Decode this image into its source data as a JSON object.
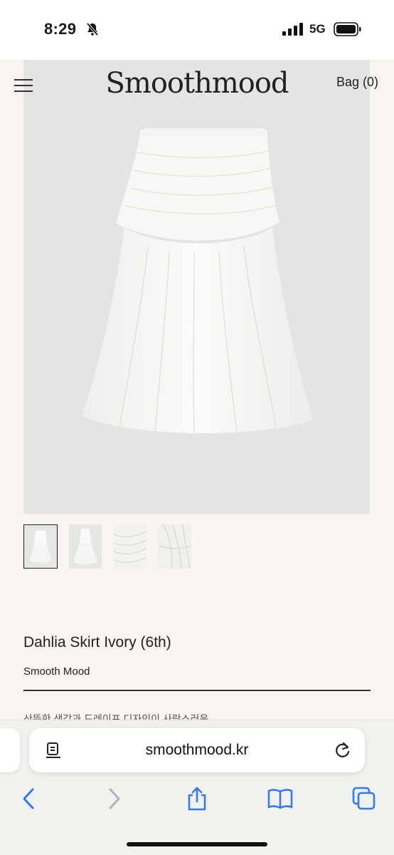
{
  "status": {
    "time": "8:29",
    "network": "5G"
  },
  "header": {
    "logo": "Smoothmood",
    "bag_label": "Bag (0)"
  },
  "product": {
    "title": "Dahlia Skirt Ivory (6th)",
    "brand": "Smooth Mood",
    "description_partial": "산뜻한 색감과 드레이프 디자인이 사랑스러운",
    "thumbnails": [
      "thumbnail-1",
      "thumbnail-2",
      "thumbnail-3",
      "thumbnail-4"
    ],
    "selected_thumbnail": 1
  },
  "browser": {
    "url": "smoothmood.kr"
  },
  "colors": {
    "page_bg": "#f8f5f0",
    "image_bg": "#e4e4e2",
    "link": "#2f7bf6"
  },
  "icons": {
    "status": [
      "bell-slash-icon",
      "signal-icon",
      "battery-icon"
    ],
    "header": [
      "hamburger-menu-icon"
    ],
    "url_bar": [
      "reader-mode-icon",
      "reload-icon"
    ],
    "toolbar": [
      "back-icon",
      "forward-icon",
      "share-icon",
      "bookmarks-icon",
      "tabs-icon"
    ]
  }
}
